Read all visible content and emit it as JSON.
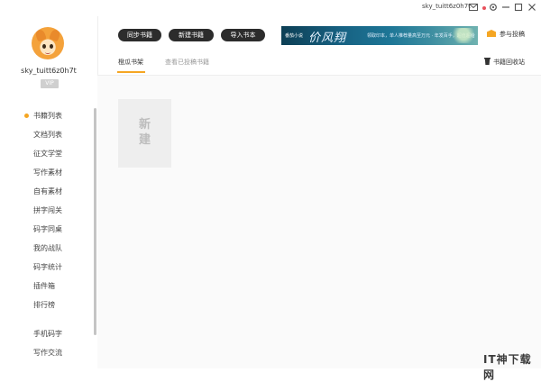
{
  "titlebar": {
    "username": "sky_tuitt6z0h7t",
    "icons": [
      "mail-icon",
      "settings-icon",
      "minimize-icon",
      "maximize-icon",
      "close-icon"
    ]
  },
  "sidebar": {
    "username": "sky_tuitt6z0h7t",
    "vip": "VIP",
    "items": [
      {
        "label": "书籍列表",
        "active": true
      },
      {
        "label": "文档列表"
      },
      {
        "label": "征文学堂"
      },
      {
        "label": "写作素材"
      },
      {
        "label": "自有素材"
      },
      {
        "label": "拼字闯关"
      },
      {
        "label": "码字同桌"
      },
      {
        "label": "我的战队"
      },
      {
        "label": "码字统计"
      },
      {
        "label": "插件箱"
      },
      {
        "label": "排行榜"
      }
    ],
    "bottom_items": [
      {
        "label": "手机码字"
      },
      {
        "label": "写作交流"
      }
    ]
  },
  "toolbar": {
    "sync_label": "同步书籍",
    "new_label": "新建书籍",
    "import_label": "导入书本",
    "participate_label": "参与投稿"
  },
  "banner": {
    "logo": "番茄小说",
    "title": "价风翔",
    "subtitle": "领取印本，单人推荐量高至万元 · 年发百手，超值超给"
  },
  "tabs": [
    {
      "label": "橙瓜书架",
      "active": true
    },
    {
      "label": "查看已投稿书籍",
      "active": false
    }
  ],
  "recycle_label": "书籍回收站",
  "new_card": {
    "line1": "新",
    "line2": "建"
  },
  "watermark": "IT神下载网",
  "colors": {
    "accent": "#f5a623",
    "button_bg": "#2c2c2c"
  }
}
